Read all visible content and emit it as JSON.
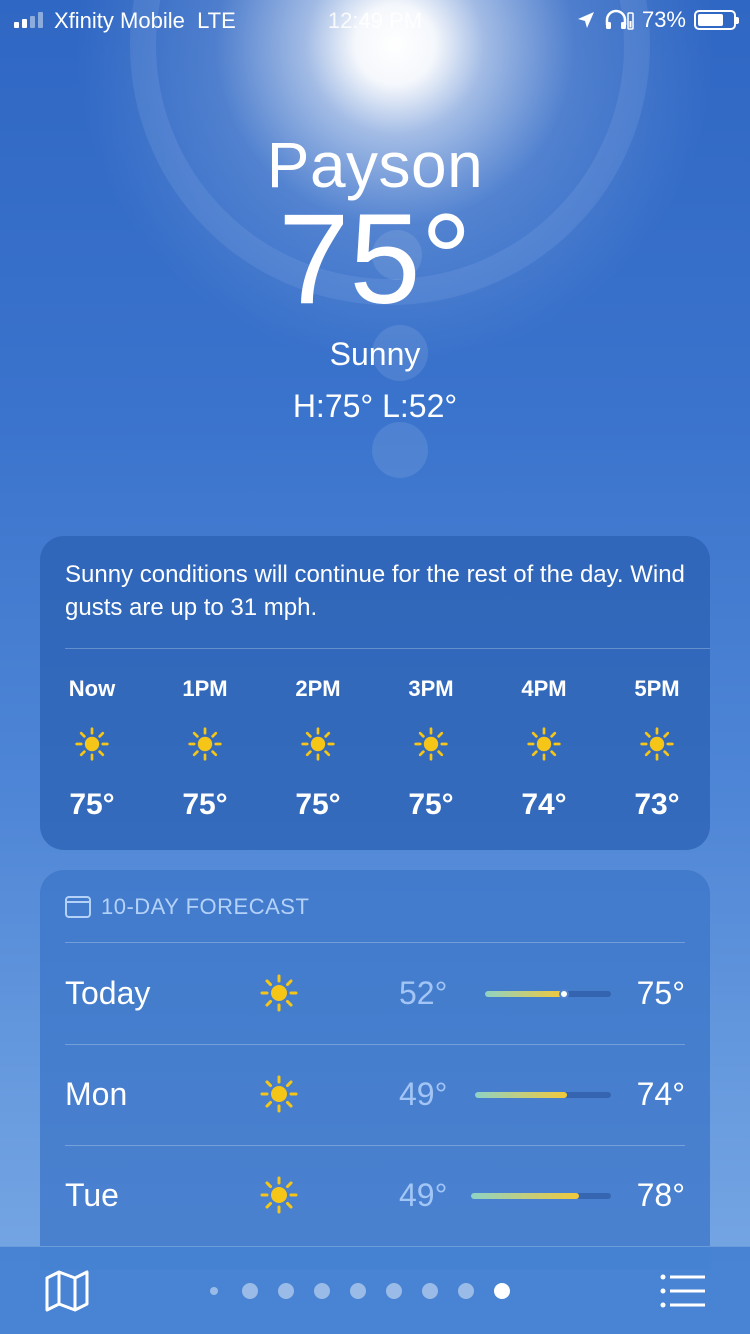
{
  "status_bar": {
    "carrier": "Xfinity Mobile",
    "network": "LTE",
    "time": "12:49 PM",
    "battery_percent": "73%",
    "battery_level": 0.73,
    "icons": [
      "location-arrow-icon",
      "headphones-icon",
      "battery-icon"
    ]
  },
  "current": {
    "city": "Payson",
    "temperature": "75°",
    "condition": "Sunny",
    "high_low": "H:75°  L:52°"
  },
  "hourly": {
    "summary": "Sunny conditions will continue for the rest of the day. Wind gusts are up to 31 mph.",
    "hours": [
      {
        "time": "Now",
        "temp": "75°",
        "icon": "sun-icon"
      },
      {
        "time": "1PM",
        "temp": "75°",
        "icon": "sun-icon"
      },
      {
        "time": "2PM",
        "temp": "75°",
        "icon": "sun-icon"
      },
      {
        "time": "3PM",
        "temp": "75°",
        "icon": "sun-icon"
      },
      {
        "time": "4PM",
        "temp": "74°",
        "icon": "sun-icon"
      },
      {
        "time": "5PM",
        "temp": "73°",
        "icon": "sun-icon"
      }
    ]
  },
  "forecast": {
    "header": "10-DAY FORECAST",
    "days": [
      {
        "day": "Today",
        "low": "52°",
        "high": "75°",
        "icon": "sun-icon"
      },
      {
        "day": "Mon",
        "low": "49°",
        "high": "74°",
        "icon": "sun-icon"
      },
      {
        "day": "Tue",
        "low": "49°",
        "high": "78°",
        "icon": "sun-icon"
      }
    ]
  },
  "colors": {
    "sun_yellow": "#f5c518",
    "bar_start": "#8fd3c4",
    "bar_end": "#f2c83a"
  },
  "bottom_bar": {
    "page_count": 9,
    "active_page": 9
  }
}
